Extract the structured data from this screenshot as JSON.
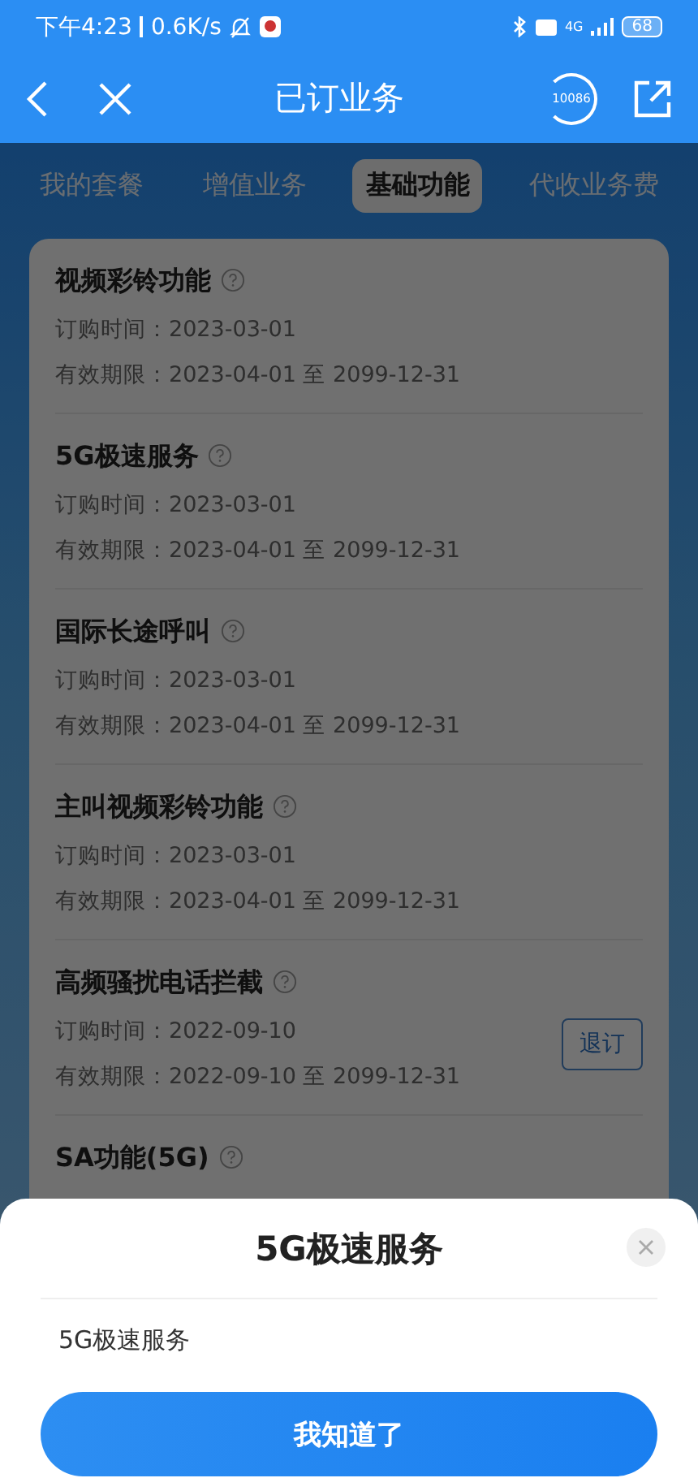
{
  "status_bar": {
    "time": "下午4:23",
    "speed": "0.6K/s",
    "network": "4G",
    "battery": "68"
  },
  "header": {
    "title": "已订业务",
    "hotline": "10086"
  },
  "tabs": [
    {
      "label": "我的套餐",
      "selected": false
    },
    {
      "label": "增值业务",
      "selected": false
    },
    {
      "label": "基础功能",
      "selected": true
    },
    {
      "label": "代收业务费",
      "selected": false
    }
  ],
  "services": [
    {
      "name": "视频彩铃功能",
      "ordered": "订购时间：2023-03-01",
      "validity": "有效期限：2023-04-01 至 2099-12-31"
    },
    {
      "name": "5G极速服务",
      "ordered": "订购时间：2023-03-01",
      "validity": "有效期限：2023-04-01 至 2099-12-31"
    },
    {
      "name": "国际长途呼叫",
      "ordered": "订购时间：2023-03-01",
      "validity": "有效期限：2023-04-01 至 2099-12-31"
    },
    {
      "name": "主叫视频彩铃功能",
      "ordered": "订购时间：2023-03-01",
      "validity": "有效期限：2023-04-01 至 2099-12-31"
    },
    {
      "name": "高频骚扰电话拦截",
      "ordered": "订购时间：2022-09-10",
      "validity": "有效期限：2022-09-10 至 2099-12-31",
      "action": "退订"
    },
    {
      "name": "SA功能(5G)"
    }
  ],
  "sheet": {
    "title": "5G极速服务",
    "body": "5G极速服务",
    "button": "我知道了"
  }
}
